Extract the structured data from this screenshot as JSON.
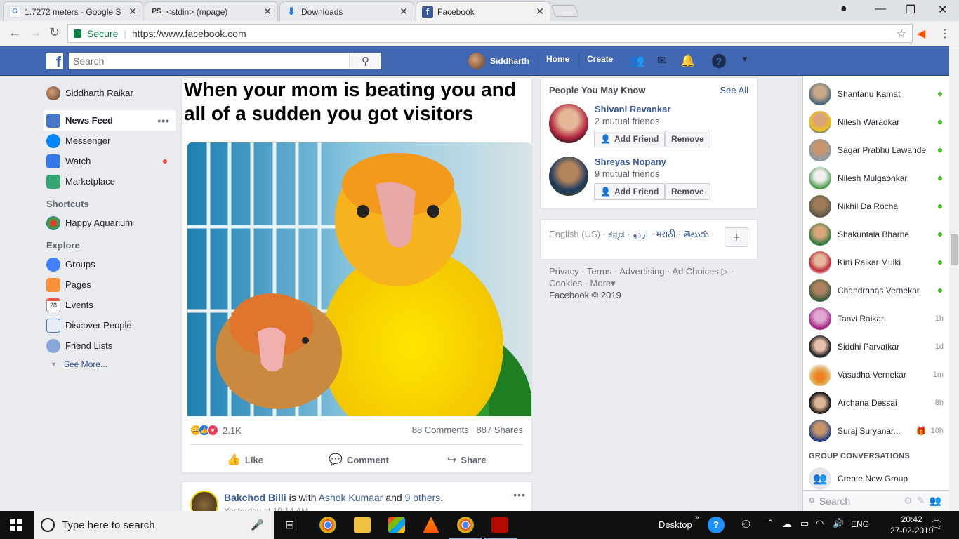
{
  "browser": {
    "tabs": [
      {
        "title": "1.7272 meters - Google S",
        "icon": "google-icon"
      },
      {
        "title": "<stdin> (mpage)",
        "icon": "pdf-document-icon"
      },
      {
        "title": "Downloads",
        "icon": "download-icon"
      },
      {
        "title": "Facebook",
        "icon": "facebook-icon"
      }
    ],
    "secure_label": "Secure",
    "url": "https://www.facebook.com"
  },
  "topbar": {
    "search_placeholder": "Search",
    "user_name": "Siddharth",
    "home": "Home",
    "create": "Create"
  },
  "leftnav": {
    "profile": "Siddharth Raikar",
    "items": [
      {
        "label": "News Feed"
      },
      {
        "label": "Messenger"
      },
      {
        "label": "Watch"
      },
      {
        "label": "Marketplace"
      }
    ],
    "shortcuts_heading": "Shortcuts",
    "shortcuts": [
      "Happy Aquarium"
    ],
    "explore_heading": "Explore",
    "explore": [
      "Groups",
      "Pages",
      "Events",
      "Discover People",
      "Friend Lists"
    ],
    "events_icon_date": "28",
    "see_more": "See More..."
  },
  "post": {
    "meme_caption": "When your mom is beating you and all of a sudden you got visitors",
    "reaction_count": "2.1K",
    "comments": "88 Comments",
    "shares": "887 Shares",
    "like": "Like",
    "comment": "Comment",
    "share": "Share"
  },
  "post2": {
    "author": "Bakchod Billi",
    "with_text": "is with",
    "tagged": "Ashok Kumaar",
    "and_text": "and",
    "others": "9 others",
    "time": "Yesterday at 10:14 AM"
  },
  "pymk": {
    "heading": "People You May Know",
    "see_all": "See All",
    "people": [
      {
        "name": "Shivani Revankar",
        "mutual": "2 mutual friends"
      },
      {
        "name": "Shreyas Nopany",
        "mutual": "9 mutual friends"
      }
    ],
    "add_friend": "Add Friend",
    "remove": "Remove"
  },
  "languages": {
    "langs": [
      "English (US)",
      "ಕನ್ನಡ",
      "اردو",
      "मराठी",
      "తెలుగు"
    ],
    "footer_links": [
      "Privacy",
      "Terms",
      "Advertising",
      "Ad Choices",
      "Cookies",
      "More"
    ],
    "copyright": "Facebook © 2019"
  },
  "chat": {
    "contacts": [
      {
        "name": "Shantanu Kamat",
        "status": "online"
      },
      {
        "name": "Nilesh Waradkar",
        "status": "online"
      },
      {
        "name": "Sagar Prabhu Lawande",
        "status": "online"
      },
      {
        "name": "Nilesh Mulgaonkar",
        "status": "online"
      },
      {
        "name": "Nikhil Da Rocha",
        "status": "online"
      },
      {
        "name": "Shakuntala Bharne",
        "status": "online"
      },
      {
        "name": "Kirti Raikar Mulki",
        "status": "online"
      },
      {
        "name": "Chandrahas Vernekar",
        "status": "online"
      },
      {
        "name": "Tanvi Raikar",
        "time": "1h"
      },
      {
        "name": "Siddhi Parvatkar",
        "time": "1d"
      },
      {
        "name": "Vasudha Vernekar",
        "time": "1m"
      },
      {
        "name": "Archana Dessai",
        "time": "8h"
      },
      {
        "name": "Suraj Suryanar...",
        "time": "10h"
      }
    ],
    "group_heading": "GROUP CONVERSATIONS",
    "create_group": "Create New Group",
    "search_placeholder": "Search"
  },
  "taskbar": {
    "search_placeholder": "Type here to search",
    "desktop": "Desktop",
    "lang": "ENG",
    "time": "20:42",
    "date": "27-02-2019"
  },
  "colors": {
    "fb_blue": "#4267b2",
    "link": "#385898",
    "online": "#42b72a"
  }
}
